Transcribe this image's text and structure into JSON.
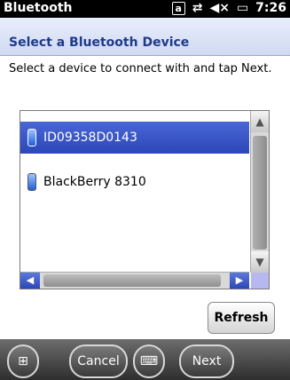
{
  "statusbar": {
    "title": "Bluetooth",
    "mode_badge": "a",
    "clock": "7:26",
    "icons": [
      "alpha-mode-icon",
      "connectivity-icon",
      "speaker-muted-icon",
      "battery-icon"
    ]
  },
  "header": {
    "title": "Select a Bluetooth Device"
  },
  "instruction": "Select a device to connect with and tap Next.",
  "devices": [
    {
      "label": "ID09358D0143",
      "selected": true
    },
    {
      "label": "BlackBerry 8310",
      "selected": false
    }
  ],
  "buttons": {
    "refresh": "Refresh",
    "cancel": "Cancel",
    "next": "Next"
  },
  "colors": {
    "selection": "#2c47b8",
    "header_text": "#1f3a8a",
    "statusbar_bg": "#000000"
  }
}
